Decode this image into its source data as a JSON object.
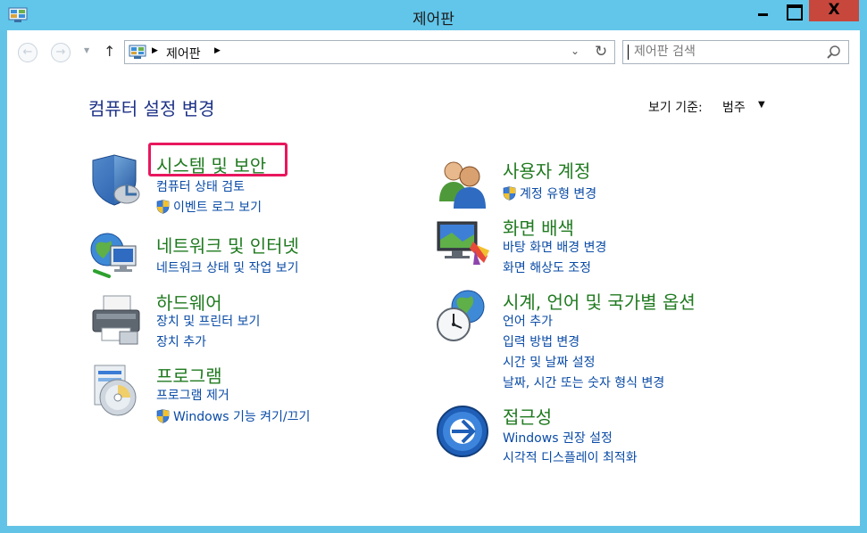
{
  "window": {
    "title": "제어판"
  },
  "titlebar": {
    "close_symbol": "X"
  },
  "address": {
    "location": "제어판"
  },
  "search": {
    "placeholder": "제어판 검색"
  },
  "header": {
    "title": "컴퓨터 설정 변경",
    "view_by_label": "보기 기준:",
    "view_by_value": "범주"
  },
  "categories": {
    "system": {
      "title": "시스템 및 보안",
      "links": [
        "컴퓨터 상태 검토",
        "이벤트 로그 보기"
      ]
    },
    "network": {
      "title": "네트워크 및 인터넷",
      "links": [
        "네트워크 상태 및 작업 보기"
      ]
    },
    "hardware": {
      "title": "하드웨어",
      "links": [
        "장치 및 프린터 보기",
        "장치 추가"
      ]
    },
    "programs": {
      "title": "프로그램",
      "links": [
        "프로그램 제거",
        "Windows 기능 켜기/끄기"
      ]
    },
    "users": {
      "title": "사용자 계정",
      "links": [
        "계정 유형 변경"
      ]
    },
    "appearance": {
      "title": "화면 배색",
      "links": [
        "바탕 화면 배경 변경",
        "화면 해상도 조정"
      ]
    },
    "clock": {
      "title": "시계, 언어 및 국가별 옵션",
      "links": [
        "언어 추가",
        "입력 방법 변경",
        "시간 및 날짜 설정",
        "날짜, 시간 또는 숫자 형식 변경"
      ]
    },
    "access": {
      "title": "접근성",
      "links": [
        "Windows 권장 설정",
        "시각적 디스플레이 최적화"
      ]
    }
  },
  "colors": {
    "accent_highlight": "#e8175d",
    "link": "#0a4ba6",
    "category_title": "#1f7a1f",
    "titlebar": "#62c6ea"
  }
}
